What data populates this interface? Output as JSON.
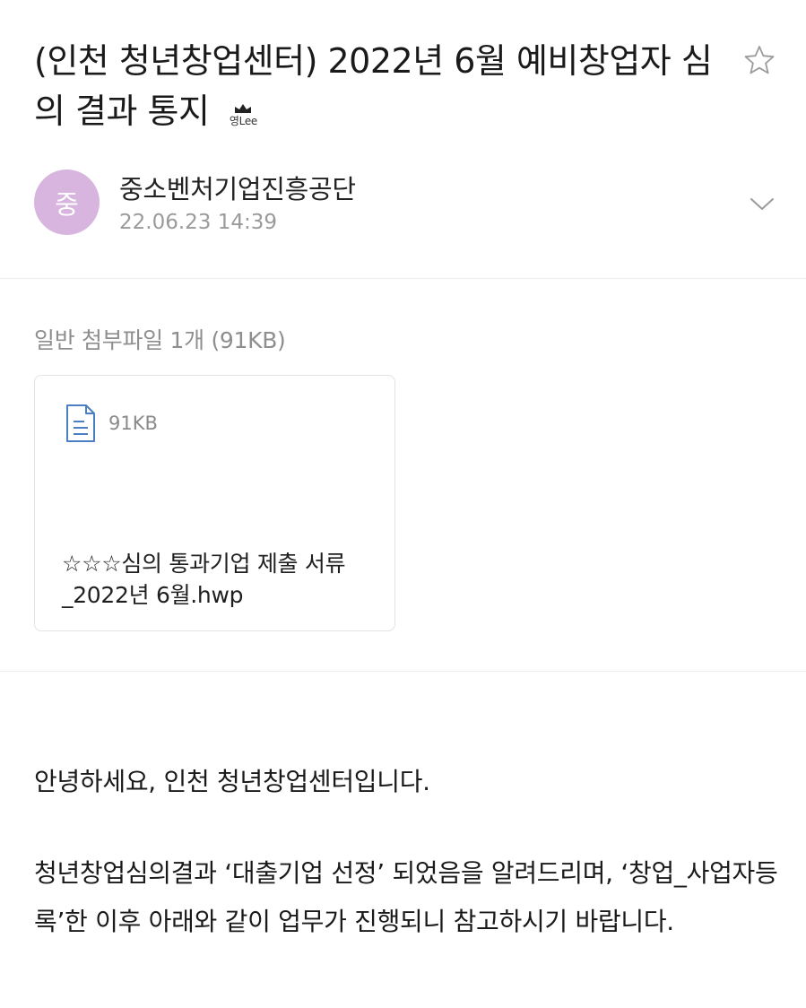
{
  "mail": {
    "subject": "(인천 청년창업센터) 2022년 6월 예비창업자 심의 결과 통지",
    "profile_tag": "영Lee",
    "sender_initial": "중",
    "sender_name": "중소벤처기업진흥공단",
    "date": "22.06.23 14:39"
  },
  "attachments": {
    "label": "일반 첨부파일 1개 (91KB)",
    "items": [
      {
        "size": "91KB",
        "name": "☆☆☆심의 통과기업 제출 서류_2022년 6월.hwp"
      }
    ]
  },
  "body": {
    "greeting": "안녕하세요, 인천 청년창업센터입니다.",
    "paragraph": "청년창업심의결과 ‘대출기업 선정’ 되었음을 알려드리며, ‘창업_사업자등록’한 이후 아래와 같이 업무가 진행되니 참고하시기 바랍니다."
  },
  "icons": {
    "star": "star-outline-icon",
    "expand": "chevron-down-icon",
    "file": "document-icon",
    "crown": "crown-icon"
  },
  "colors": {
    "avatar_bg": "#d7b5de",
    "file_icon": "#4a7fc1",
    "muted_text": "#9a9a9a"
  }
}
